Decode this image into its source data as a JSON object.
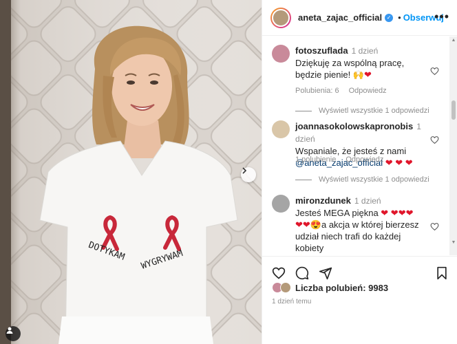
{
  "post": {
    "username": "aneta_zajac_official",
    "follow_label": "Obserwuj",
    "likes_label": "Liczba polubień: 9983",
    "posted_ago": "1 dzień temu"
  },
  "photo": {
    "shirt_text_left": "DOTYKAM",
    "shirt_text_right": "WYGRYWAM"
  },
  "comments": [
    {
      "user": "fotoszuflada",
      "time": "1 dzień",
      "text": "Dziękuję za wspólną pracę, będzie pienie! 🙌",
      "emoji_tail": "❤",
      "likes": "Polubienia: 6",
      "reply": "Odpowiedz",
      "view_replies": "Wyświetl wszystkie 1 odpowiedzi",
      "avatar_color": "#c98a9a"
    },
    {
      "user": "joannasokolowskapronobis",
      "time": "1 dzień",
      "text": "Wspaniale, że jesteś z nami",
      "mention": "@aneta_zajac_official",
      "emoji_tail": "❤ ❤ ❤",
      "likes": "1 polubienie",
      "reply": "Odpowiedz",
      "view_replies": "Wyświetl wszystkie 1 odpowiedzi",
      "avatar_color": "#d9c6a8"
    },
    {
      "user": "mironzdunek",
      "time": "1 dzień",
      "text_a": "Jesteś MEGA piękna",
      "emoji_a": "❤ ❤❤❤",
      "emoji_b": "❤❤😍",
      "text_b": "a akcja w której bierzesz udział niech trafi do każdej kobiety",
      "emoji_c": "👍",
      "avatar_color": "#a5a5a5"
    }
  ],
  "colors": {
    "accent": "#0095f6",
    "verified": "#3897f0",
    "heart": "#e0162b",
    "muted": "#8e8e8e"
  },
  "icons": [
    "verified-badge-icon",
    "more-options-icon",
    "heart-icon",
    "comment-icon",
    "share-icon",
    "bookmark-icon",
    "next-arrow-icon",
    "tag-user-icon"
  ]
}
